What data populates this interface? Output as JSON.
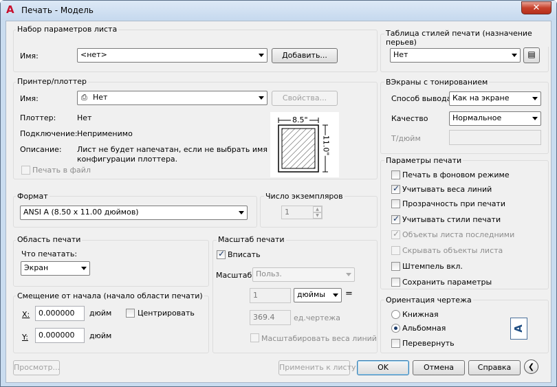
{
  "window": {
    "title": "Печать - Модель",
    "close_label": "✕"
  },
  "page_setup": {
    "group_title": "Набор параметров листа",
    "name_label": "Имя:",
    "name_value": "<нет>",
    "add_button": "Добавить..."
  },
  "printer": {
    "group_title": "Принтер/плоттер",
    "name_label": "Имя:",
    "name_value": "Нет",
    "properties_button": "Свойства...",
    "plotter_label": "Плоттер:",
    "plotter_value": "Нет",
    "connection_label": "Подключение:",
    "connection_value": "Неприменимо",
    "description_label": "Описание:",
    "description_value_1": "Лист не будет напечатан, если не выбрать имя",
    "description_value_2": "конфигурации плоттера.",
    "print_to_file": "Печать в файл",
    "preview_width": "8.5\"",
    "preview_height": "11.0\""
  },
  "format": {
    "group_title": "Формат",
    "value": "ANSI A (8.50 x 11.00 дюймов)"
  },
  "copies": {
    "group_title": "Число экземпляров",
    "value": "1"
  },
  "plot_area": {
    "group_title": "Область печати",
    "what_label": "Что печатать:",
    "value": "Экран"
  },
  "offset": {
    "group_title": "Смещение от начала (начало области печати)",
    "x_label": "X:",
    "x_value": "0.000000",
    "x_unit": "дюйм",
    "y_label": "Y:",
    "y_value": "0.000000",
    "y_unit": "дюйм",
    "center_label": "Центрировать"
  },
  "scale": {
    "group_title": "Масштаб печати",
    "fit_label": "Вписать",
    "scale_label": "Масштаб:",
    "scale_value": "Польз.",
    "value1": "1",
    "units_value": "дюймы",
    "equals": "=",
    "value2": "369.4",
    "units2": "ед.чертежа",
    "lineweights_label": "Масштабировать веса линий"
  },
  "style_table": {
    "group_title": "Таблица стилей печати (назначение перьев)",
    "value": "Нет"
  },
  "shaded": {
    "group_title": "ВЭкраны с тонированием",
    "output_label": "Способ вывода",
    "output_value": "Как на экране",
    "quality_label": "Качество",
    "quality_value": "Нормальное",
    "dpi_label": "Т/дюйм",
    "dpi_value": ""
  },
  "options": {
    "group_title": "Параметры печати",
    "items": [
      {
        "label": "Печать в фоновом режиме",
        "checked": false,
        "disabled": false
      },
      {
        "label": "Учитывать веса линий",
        "checked": true,
        "disabled": false
      },
      {
        "label": "Прозрачность при печати",
        "checked": false,
        "disabled": false
      },
      {
        "label": "Учитывать стили печати",
        "checked": true,
        "disabled": false
      },
      {
        "label": "Объекты листа последними",
        "checked": true,
        "disabled": true
      },
      {
        "label": "Скрывать объекты листа",
        "checked": false,
        "disabled": true
      },
      {
        "label": "Штемпель вкл.",
        "checked": false,
        "disabled": false
      },
      {
        "label": "Сохранить параметры",
        "checked": false,
        "disabled": false
      }
    ]
  },
  "orientation": {
    "group_title": "Ориентация чертежа",
    "portrait": "Книжная",
    "landscape": "Альбомная",
    "upside_down": "Перевернуть",
    "selected": "landscape",
    "icon_letter": "A"
  },
  "footer": {
    "preview": "Просмотр...",
    "apply": "Применить к листу",
    "ok": "OK",
    "cancel": "Отмена",
    "help": "Справка",
    "collapse_icon": "❮"
  }
}
